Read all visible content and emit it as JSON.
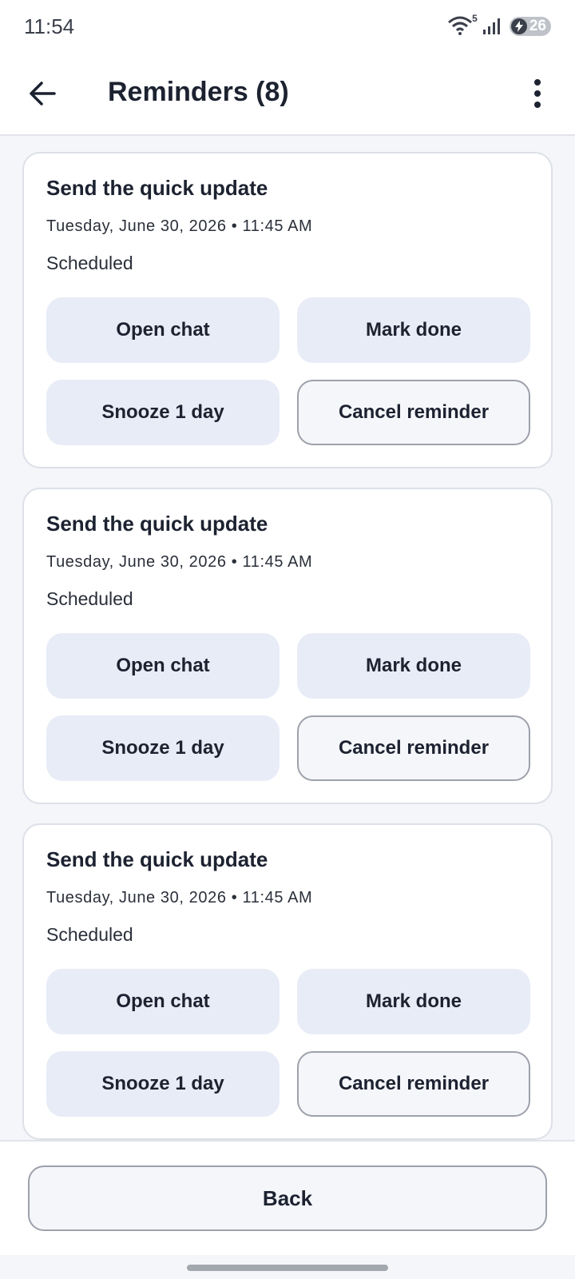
{
  "status_bar": {
    "time": "11:54",
    "wifi_badge": "5",
    "battery_level": "26",
    "icons": [
      "wifi-icon",
      "signal-icon",
      "battery-charging-icon"
    ]
  },
  "header": {
    "title": "Reminders (8)",
    "back_icon": "arrow-left-icon",
    "menu_icon": "more-vertical-icon"
  },
  "reminders": [
    {
      "title": "Send the quick update",
      "datetime": "Tuesday, June 30, 2026 • 11:45 AM",
      "status": "Scheduled",
      "actions": {
        "open": "Open chat",
        "done": "Mark done",
        "snooze": "Snooze 1 day",
        "cancel": "Cancel reminder"
      }
    },
    {
      "title": "Send the quick update",
      "datetime": "Tuesday, June 30, 2026 • 11:45 AM",
      "status": "Scheduled",
      "actions": {
        "open": "Open chat",
        "done": "Mark done",
        "snooze": "Snooze 1 day",
        "cancel": "Cancel reminder"
      }
    },
    {
      "title": "Send the quick update",
      "datetime": "Tuesday, June 30, 2026 • 11:45 AM",
      "status": "Scheduled",
      "actions": {
        "open": "Open chat",
        "done": "Mark done",
        "snooze": "Snooze 1 day",
        "cancel": "Cancel reminder"
      }
    }
  ],
  "footer": {
    "back_label": "Back"
  },
  "colors": {
    "background": "#f5f6fa",
    "card": "#ffffff",
    "tonal_button": "#e8ecf7",
    "outline": "#9da1ab",
    "text": "#1c2230"
  }
}
